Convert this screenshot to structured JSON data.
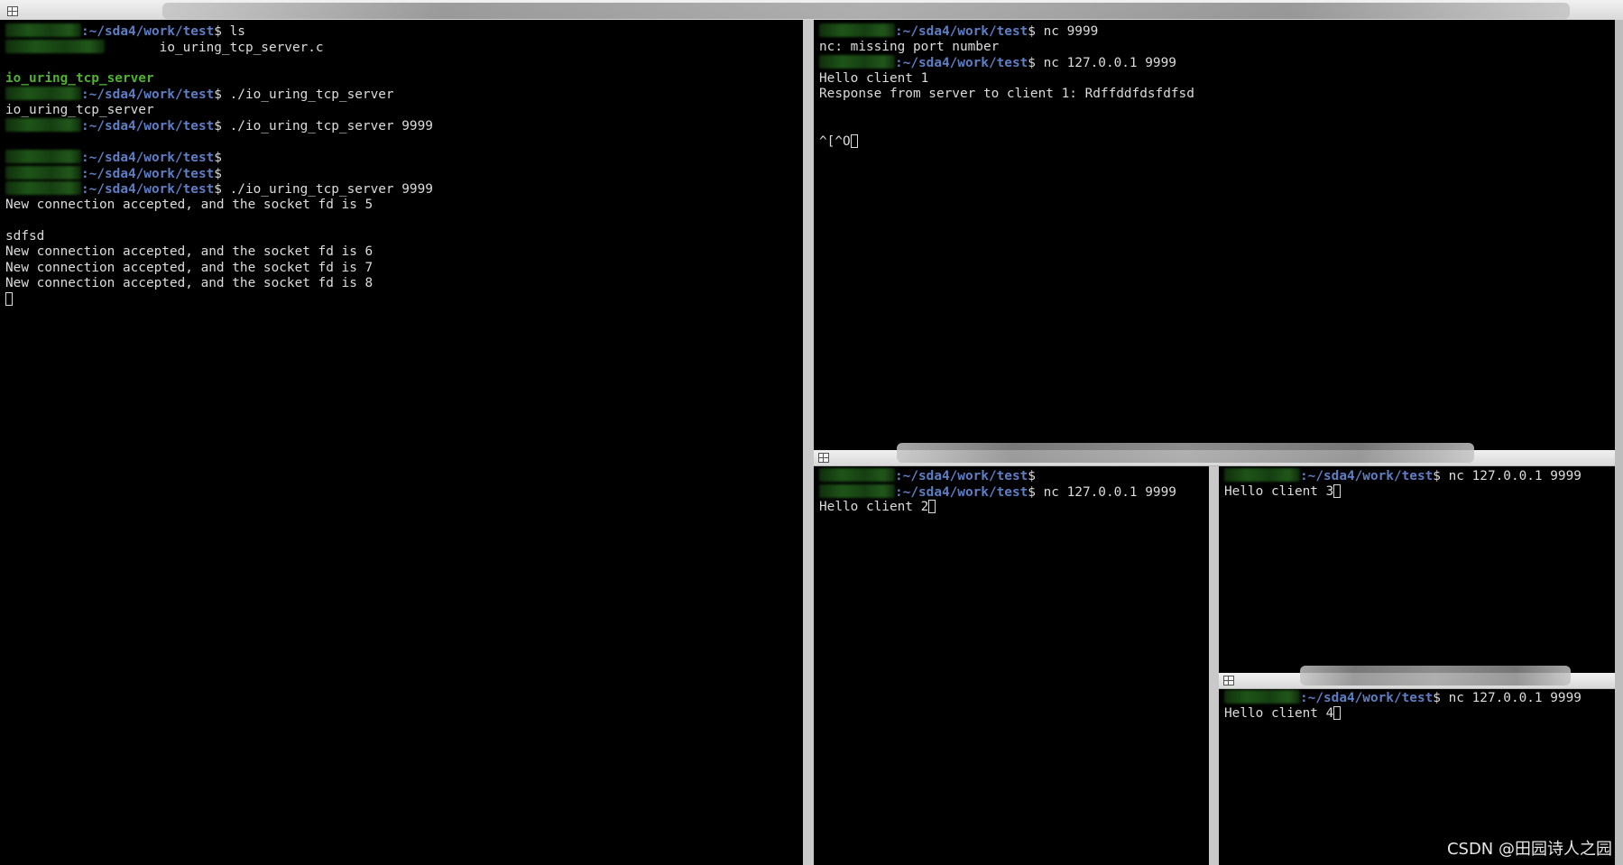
{
  "prompt": {
    "path": ":~/sda4/work/test",
    "dollar": "$"
  },
  "left_pane": {
    "lines": [
      {
        "type": "prompt",
        "cmd": " ls"
      },
      {
        "type": "listing",
        "text": "io_uring_tcp_server.c"
      },
      {
        "type": "blank"
      },
      {
        "type": "exe",
        "text": "io_uring_tcp_server"
      },
      {
        "type": "prompt",
        "cmd": " ./io_uring_tcp_server"
      },
      {
        "type": "text",
        "text": "io_uring_tcp_server"
      },
      {
        "type": "prompt",
        "cmd": " ./io_uring_tcp_server 9999"
      },
      {
        "type": "blank"
      },
      {
        "type": "prompt",
        "cmd": ""
      },
      {
        "type": "prompt",
        "cmd": ""
      },
      {
        "type": "prompt",
        "cmd": " ./io_uring_tcp_server 9999"
      },
      {
        "type": "text",
        "text": "New connection accepted, and the socket fd is 5"
      },
      {
        "type": "blank"
      },
      {
        "type": "text",
        "text": "sdfsd"
      },
      {
        "type": "text",
        "text": "New connection accepted, and the socket fd is 6"
      },
      {
        "type": "text",
        "text": "New connection accepted, and the socket fd is 7"
      },
      {
        "type": "text",
        "text": "New connection accepted, and the socket fd is 8"
      },
      {
        "type": "cursor"
      }
    ]
  },
  "top_right_pane": {
    "lines": [
      {
        "type": "prompt",
        "cmd": " nc 9999"
      },
      {
        "type": "text",
        "text": "nc: missing port number"
      },
      {
        "type": "prompt",
        "cmd": " nc 127.0.0.1 9999"
      },
      {
        "type": "text",
        "text": "Hello client 1"
      },
      {
        "type": "text",
        "text": "Response from server to client 1: Rdffddfdsfdfsd"
      },
      {
        "type": "blank"
      },
      {
        "type": "blank"
      },
      {
        "type": "text_cursor",
        "text": "^[^O"
      }
    ]
  },
  "client2_pane": {
    "lines": [
      {
        "type": "prompt",
        "cmd": ""
      },
      {
        "type": "prompt",
        "cmd": " nc 127.0.0.1 9999"
      },
      {
        "type": "text_cursor",
        "text": "Hello client 2"
      }
    ]
  },
  "client3_pane": {
    "lines": [
      {
        "type": "prompt",
        "cmd": " nc 127.0.0.1 9999"
      },
      {
        "type": "text_cursor",
        "text": "Hello client 3"
      }
    ]
  },
  "client4_pane": {
    "lines": [
      {
        "type": "prompt",
        "cmd": " nc 127.0.0.1 9999"
      },
      {
        "type": "text_cursor",
        "text": "Hello client 4"
      }
    ]
  },
  "watermark": "CSDN @田园诗人之园"
}
